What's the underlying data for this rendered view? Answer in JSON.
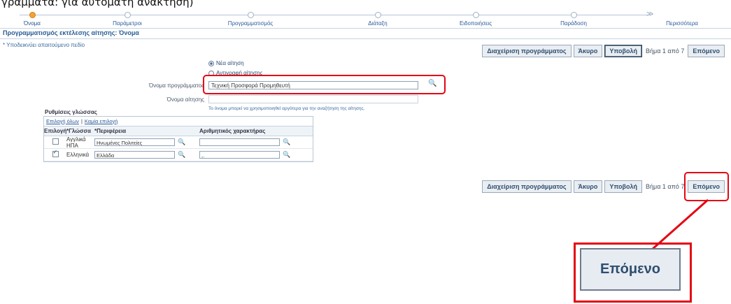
{
  "caption": "γραμματα: για αυτόματη ανάκτηση)",
  "train": {
    "steps": [
      "Όνομα",
      "Παράμετροι",
      "Προγραμματισμός",
      "Διάταξη",
      "Ειδοποιήσεις",
      "Παράδοση",
      "Περισσότερα"
    ]
  },
  "page": {
    "title": "Προγραμματισμός εκτέλεσης αίτησης: Όνομα",
    "required_note": "* Υποδεικνύει απαιτούμενο πεδίο"
  },
  "buttons": {
    "manage": "Διαχείριση προγράμματος",
    "cancel": "Άκυρο",
    "submit": "Υποβολή",
    "step_info": "Βήμα 1 από 7",
    "next": "Επόμενο"
  },
  "form": {
    "radio_new": "Νέα αίτηση",
    "radio_copy": "Αντιγραφή αίτησης",
    "program_label": "Όνομα προγράμματος",
    "program_value": "Τεχνική Προσφορά Προμηθευτή",
    "request_label": "Όνομα αίτησης",
    "request_value": "",
    "request_hint": "Το όνομα μπορεί να χρησιμοποιηθεί αργότερα για την αναζήτηση της αίτησης."
  },
  "language": {
    "section_title": "Ρυθμίσεις γλώσσας",
    "select_all": "Επιλογή όλων",
    "select_none": "Καμία επιλογή",
    "columns": [
      "Επιλογή",
      "*Γλώσσα",
      "*Περιφέρεια",
      "Αριθμητικός χαρακτήρας"
    ],
    "rows": [
      {
        "checked": false,
        "language": "Αγγλικά ΗΠΑ",
        "territory": "Ηνωμένες Πολιτείες",
        "numeric": ""
      },
      {
        "checked": true,
        "language": "Ελληνικά",
        "territory": "Ελλάδα",
        "numeric": ",."
      }
    ]
  },
  "zoom": {
    "label": "Επόμενο"
  },
  "colors": {
    "highlight": "#e30713",
    "link": "#2a5a9a"
  }
}
